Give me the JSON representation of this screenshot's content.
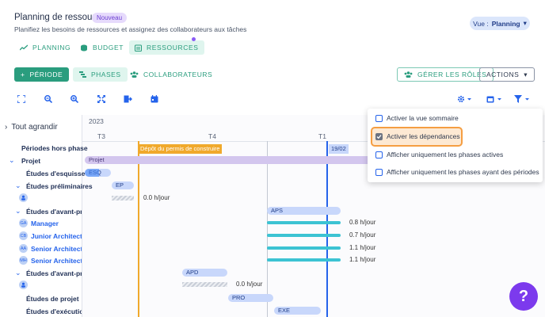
{
  "header": {
    "title": "Planning de ressources",
    "badge": "Nouveau",
    "subtitle": "Planifiez les besoins de ressources et assignez des collaborateurs aux tâches",
    "view_label": "Vue :",
    "view_value": "Planning"
  },
  "tabs": [
    {
      "label": "PLANNING",
      "icon": "trend-icon"
    },
    {
      "label": "BUDGET",
      "icon": "coins-icon"
    },
    {
      "label": "RESSOURCES",
      "icon": "calendar-list-icon"
    }
  ],
  "actions": {
    "periode": "PÉRIODE",
    "phases": "PHASES",
    "collaborateurs": "COLLABORATEURS",
    "gerer_roles": "GÉRER LES RÔLES",
    "actions": "ACTIONS"
  },
  "gantt": {
    "expand_all": "Tout agrandir",
    "year": "2023",
    "quarters": [
      "T3",
      "T4",
      "T1"
    ],
    "milestone": "Dépôt du permis de construire",
    "today_label": "19/02",
    "rows": [
      {
        "label": "Périodes hors phase",
        "kind": "heading"
      },
      {
        "label": "Projet",
        "kind": "group",
        "bar": "Projet"
      },
      {
        "label": "Études d'esquisse",
        "kind": "phase",
        "bar": "ESQ"
      },
      {
        "label": "Études préliminaires",
        "kind": "phase",
        "bar": "EP"
      },
      {
        "label": "",
        "kind": "unassigned",
        "hours": "0.0 h/jour"
      },
      {
        "label": "Études d'avant-projet sommaire",
        "kind": "phase",
        "bar": "APS"
      },
      {
        "label": "Manager",
        "kind": "person",
        "initials": "GA",
        "hours": "0.8 h/jour"
      },
      {
        "label": "Junior Architect",
        "kind": "person",
        "initials": "CB",
        "hours": "0.7 h/jour"
      },
      {
        "label": "Senior Architect",
        "kind": "person",
        "initials": "AA",
        "hours": "1.1 h/jour"
      },
      {
        "label": "Senior Architect",
        "kind": "person",
        "initials": "MH",
        "hours": "1.1 h/jour"
      },
      {
        "label": "Études d'avant-projet définitif",
        "kind": "phase",
        "bar": "APD"
      },
      {
        "label": "",
        "kind": "unassigned",
        "hours": "0.0 h/jour"
      },
      {
        "label": "Études de projet",
        "kind": "phase",
        "bar": "PRO"
      },
      {
        "label": "Études d'exécution",
        "kind": "phase",
        "bar": "EXE"
      }
    ]
  },
  "menu": [
    {
      "label": "Activer la vue sommaire",
      "checked": false
    },
    {
      "label": "Activer les dépendances",
      "checked": true
    },
    {
      "label": "Afficher uniquement les phases actives",
      "checked": false
    },
    {
      "label": "Afficher uniquement les phases ayant des périodes",
      "checked": false
    }
  ],
  "help": "?",
  "colors": {
    "accent_green": "#2a9d7e",
    "accent_blue": "#2563eb",
    "milestone": "#f0a92c",
    "purple": "#7c3aed",
    "highlight": "#f59e42"
  }
}
